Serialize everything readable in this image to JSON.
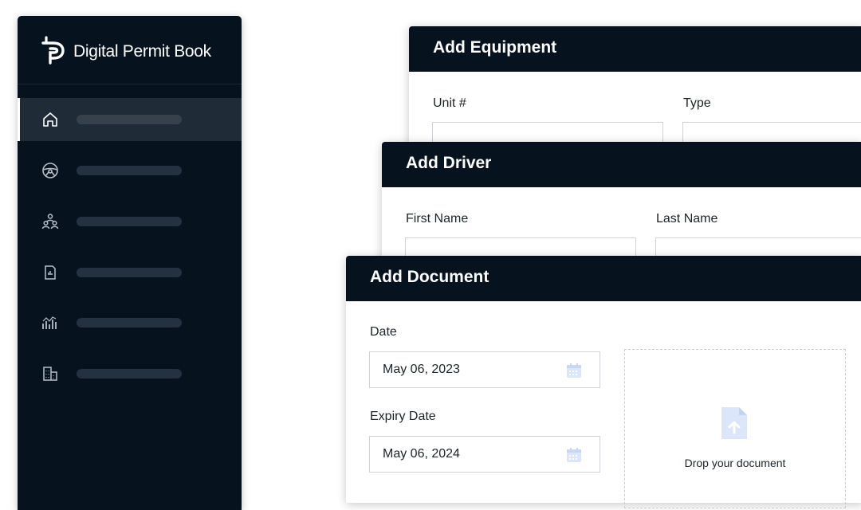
{
  "brand": {
    "name": "Digital Permit Book"
  },
  "sidebar": {
    "items": [
      {
        "icon": "home-icon",
        "active": true
      },
      {
        "icon": "steering-wheel-icon",
        "active": false
      },
      {
        "icon": "people-icon",
        "active": false
      },
      {
        "icon": "document-icon",
        "active": false
      },
      {
        "icon": "bar-chart-icon",
        "active": false
      },
      {
        "icon": "building-icon",
        "active": false
      }
    ]
  },
  "equipment_card": {
    "title": "Add Equipment",
    "unit_label": "Unit #",
    "type_label": "Type"
  },
  "driver_card": {
    "title": "Add Driver",
    "first_name_label": "First Name",
    "last_name_label": "Last Name"
  },
  "document_card": {
    "title": "Add Document",
    "date_label": "Date",
    "date_value": "May 06, 2023",
    "expiry_label": "Expiry Date",
    "expiry_value": "May 06, 2024",
    "drop_label": "Drop your document"
  },
  "colors": {
    "navy": "#06131f",
    "active_item": "#1f2b37",
    "icon_tint": "#dbe6fb"
  }
}
